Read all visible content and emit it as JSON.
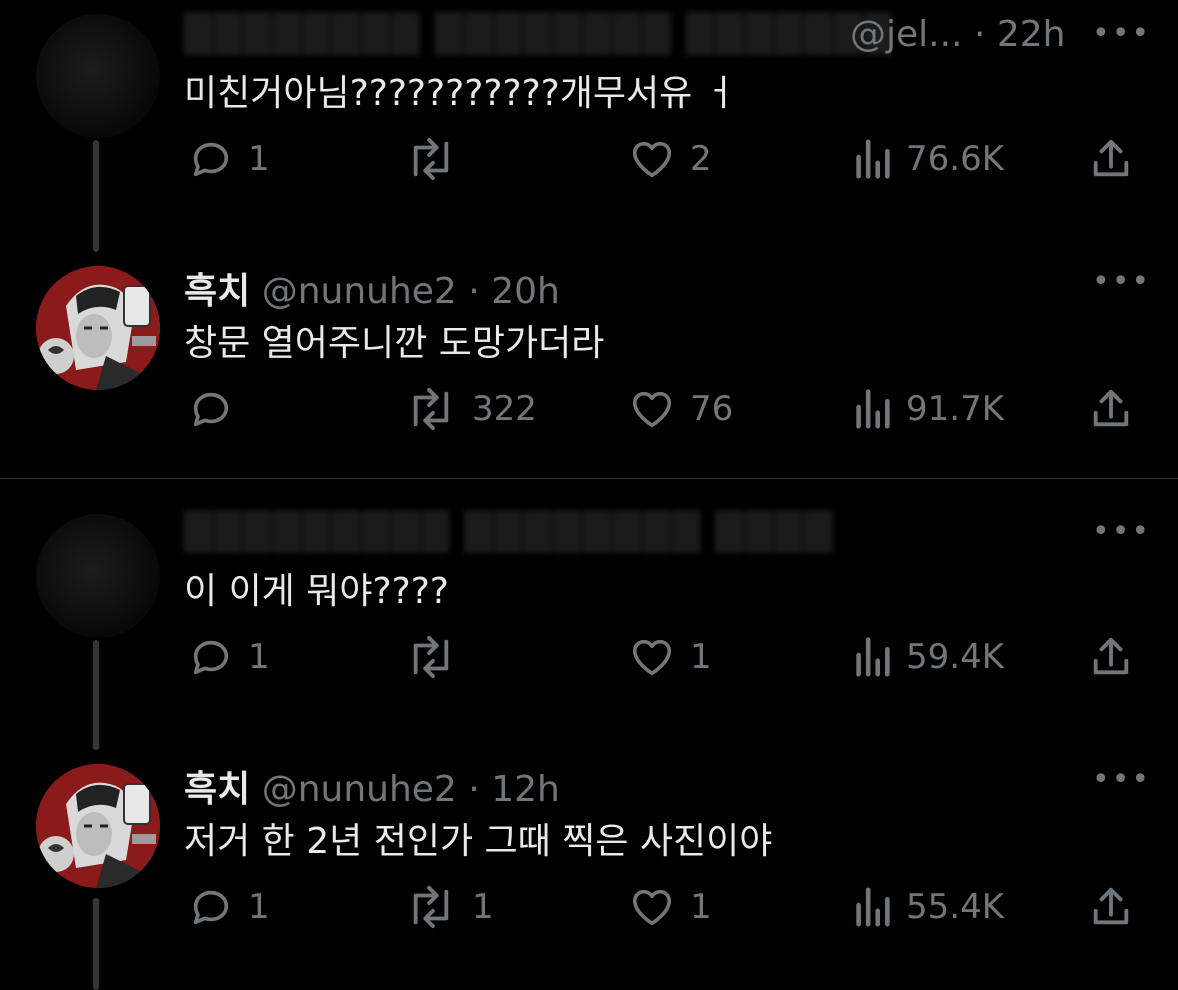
{
  "tweets": [
    {
      "name": "",
      "handle": "@jel...",
      "time": "22h",
      "text": "미친거아님???????????개무서유 ㅓ",
      "replies": "1",
      "retweets": "",
      "likes": "2",
      "views": "76.6K",
      "avatar": "blurred"
    },
    {
      "name": "흑치",
      "handle": "@nunuhe2",
      "time": "20h",
      "text": "창문 열어주니깐 도망가더라",
      "replies": "",
      "retweets": "322",
      "likes": "76",
      "views": "91.7K",
      "avatar": "manga-profile"
    },
    {
      "name": "",
      "handle": "",
      "time": "",
      "text": "이 이게 뭐야????",
      "replies": "1",
      "retweets": "",
      "likes": "1",
      "views": "59.4K",
      "avatar": "blurred"
    },
    {
      "name": "흑치",
      "handle": "@nunuhe2",
      "time": "12h",
      "text": "저거 한 2년 전인가 그때 찍은 사진이야",
      "replies": "1",
      "retweets": "1",
      "likes": "1",
      "views": "55.4K",
      "avatar": "manga-profile"
    }
  ],
  "separator": "·",
  "icons": {
    "reply": "reply-icon",
    "retweet": "retweet-icon",
    "like": "heart-icon",
    "views": "views-chart-icon",
    "share": "share-icon",
    "more": "more-dots-icon"
  },
  "colors": {
    "background": "#000000",
    "text": "#e7e9ea",
    "muted": "#71767b",
    "avatar_red": "#8b1a1a"
  }
}
